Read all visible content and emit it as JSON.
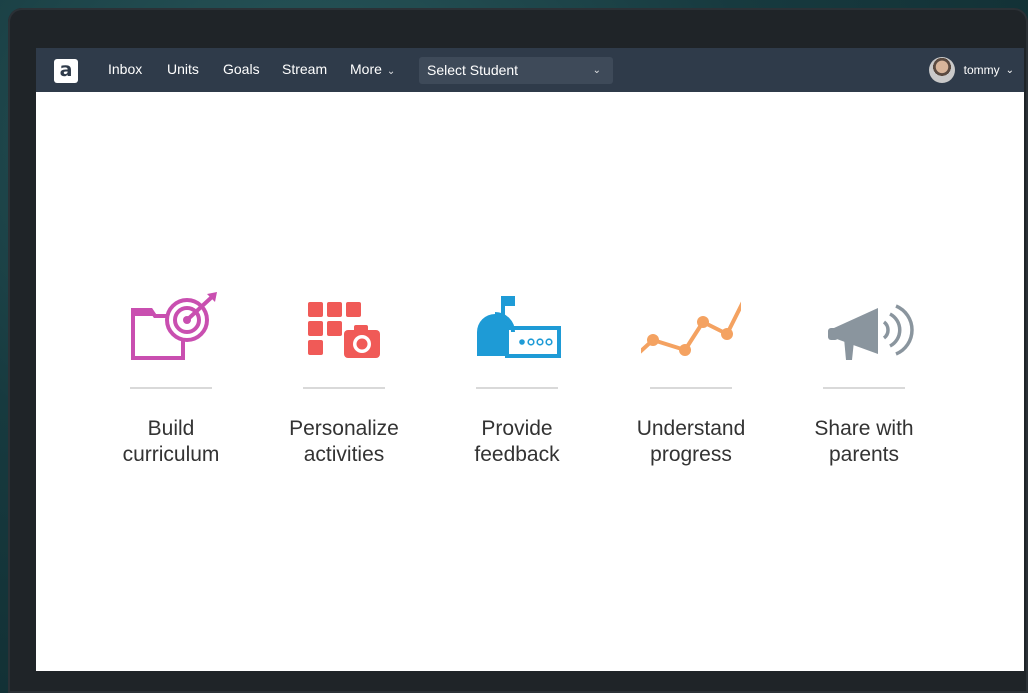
{
  "navbar": {
    "logo_letter": "a",
    "items": [
      {
        "label": "Inbox"
      },
      {
        "label": "Units"
      },
      {
        "label": "Goals"
      },
      {
        "label": "Stream"
      },
      {
        "label": "More"
      }
    ],
    "select_student": "Select Student",
    "user_name": "tommy"
  },
  "features": [
    {
      "line1": "Build",
      "line2": "curriculum",
      "icon": "target-folder-icon",
      "color": "#c94fb0"
    },
    {
      "line1": "Personalize",
      "line2": "activities",
      "icon": "grid-camera-icon",
      "color": "#f05a57"
    },
    {
      "line1": "Provide",
      "line2": "feedback",
      "icon": "mailbox-icon",
      "color": "#1e9bd6"
    },
    {
      "line1": "Understand",
      "line2": "progress",
      "icon": "line-graph-icon",
      "color": "#f4a261"
    },
    {
      "line1": "Share with",
      "line2": "parents",
      "icon": "megaphone-icon",
      "color": "#8a959e"
    }
  ],
  "colors": {
    "navbar_bg": "#2f3b4a",
    "select_bg": "#3e4a59",
    "screen_bg": "#ffffff",
    "text": "#333333"
  }
}
